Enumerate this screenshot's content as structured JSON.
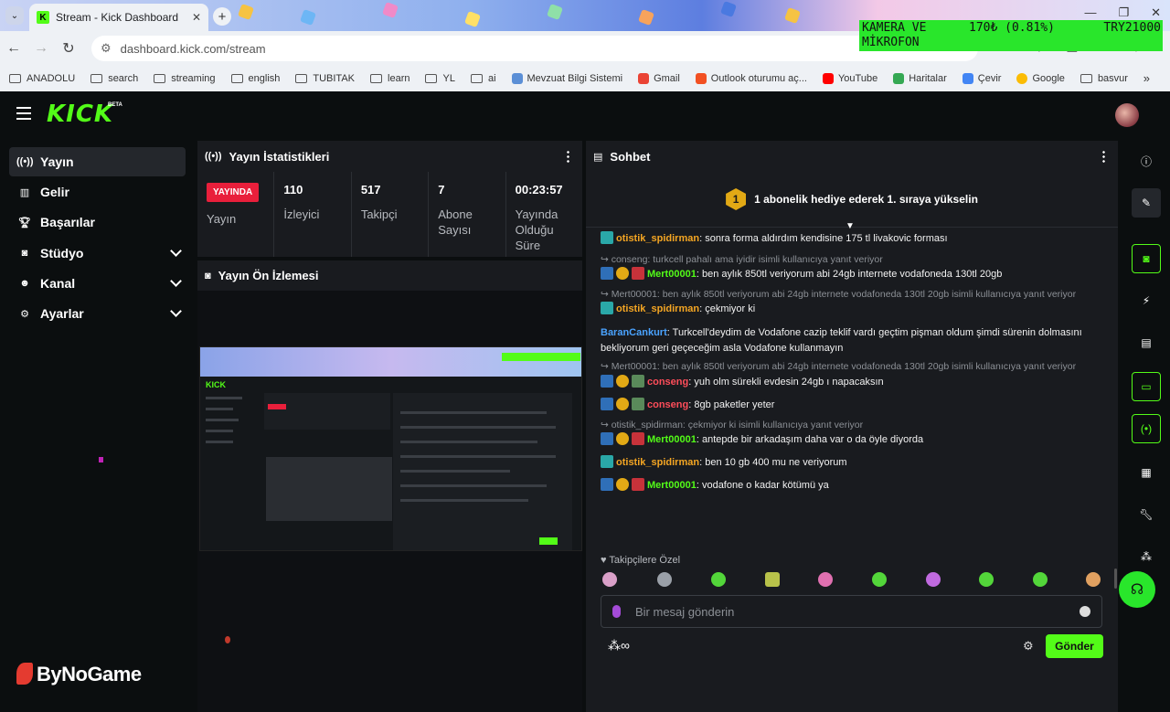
{
  "browser": {
    "tab_title": "Stream - Kick Dashboard",
    "url": "dashboard.kick.com/stream",
    "overlay_label": "KAMERA VE MİKROFON",
    "overlay_price": "170₺ (0.81%)",
    "overlay_amount": "TRY21000",
    "bookmarks": [
      "ANADOLU",
      "search",
      "streaming",
      "english",
      "TUBITAK",
      "learn",
      "YL",
      "ai",
      "Mevzuat Bilgi Sistemi",
      "Gmail",
      "Outlook oturumu aç...",
      "YouTube",
      "Haritalar",
      "Çevir",
      "Google",
      "basvur"
    ]
  },
  "app": {
    "logo": "KICK",
    "beta": "BETA"
  },
  "sidebar": {
    "items": [
      {
        "label": "Yayın",
        "icon": "broadcast-icon"
      },
      {
        "label": "Gelir",
        "icon": "chart-icon"
      },
      {
        "label": "Başarılar",
        "icon": "trophy-icon"
      },
      {
        "label": "Stüdyo",
        "icon": "studio-icon"
      },
      {
        "label": "Kanal",
        "icon": "people-icon"
      },
      {
        "label": "Ayarlar",
        "icon": "gear-icon"
      }
    ],
    "watermark": "ByNoGame"
  },
  "stats": {
    "title": "Yayın İstatistikleri",
    "live_badge": "YAYINDA",
    "live_label": "Yayın",
    "items": [
      {
        "value": "110",
        "label": "İzleyici"
      },
      {
        "value": "517",
        "label": "Takipçi"
      },
      {
        "value": "7",
        "label": "Abone Sayısı"
      },
      {
        "value": "00:23:57",
        "label": "Yayında Olduğu Süre"
      }
    ]
  },
  "preview": {
    "title": "Yayın Ön İzlemesi"
  },
  "chat": {
    "title": "Sohbet",
    "pinned": "1 abonelik hediye ederek 1. sıraya yükselin",
    "pinned_rank": "1",
    "messages": [
      {
        "reply": "",
        "user": "otistik_spidirman",
        "color": "orange",
        "text": "sonra forma aldırdım kendisine 175 tl livakovic forması"
      },
      {
        "reply": "conseng: turkcell pahalı ama iyidir isimli kullanıcıya yanıt veriyor",
        "user": "Mert00001",
        "color": "green",
        "text": "ben aylık 850tl veriyorum abi 24gb internete vodafoneda 130tl 20gb"
      },
      {
        "reply": "Mert00001: ben aylık 850tl veriyorum abi 24gb internete vodafoneda 130tl 20gb isimli kullanıcıya yanıt veriyor",
        "user": "otistik_spidirman",
        "color": "orange",
        "text": "çekmiyor ki"
      },
      {
        "reply": "",
        "user": "BaranCankurt",
        "color": "blue",
        "text": "Turkcell'deydim de Vodafone cazip teklif vardı geçtim pişman oldum şimdi sürenin dolmasını bekliyorum geri geçeceğim asla Vodafone kullanmayın"
      },
      {
        "reply": "Mert00001: ben aylık 850tl veriyorum abi 24gb internete vodafoneda 130tl 20gb isimli kullanıcıya yanıt veriyor",
        "user": "conseng",
        "color": "red",
        "text": "yuh olm sürekli evdesin 24gb ı napacaksın"
      },
      {
        "reply": "",
        "user": "conseng",
        "color": "red",
        "text": "8gb paketler yeter"
      },
      {
        "reply": "otistik_spidirman: çekmiyor ki isimli kullanıcıya yanıt veriyor",
        "user": "Mert00001",
        "color": "green",
        "text": "antepde bir arkadaşım daha var o da öyle diyorda"
      },
      {
        "reply": "",
        "user": "otistik_spidirman",
        "color": "orange",
        "text": "ben 10 gb 400 mu ne veriyorum"
      },
      {
        "reply": "",
        "user": "Mert00001",
        "color": "green",
        "text": "vodafone o kadar kötümü ya"
      }
    ],
    "followers_only": "Takipçilere Özel",
    "input_placeholder": "Bir mesaj gönderin",
    "send_label": "Gönder"
  },
  "rail": {
    "icons": [
      "info-icon",
      "pencil-icon",
      "camera-icon",
      "bolt-icon",
      "notes-icon",
      "chat-icon",
      "broadcast-icon",
      "layout-icon",
      "wrench-icon",
      "share-icon"
    ]
  },
  "colors": {
    "accent": "#53fc18",
    "live": "#e91f3b",
    "bg": "#0b0e0f",
    "panel": "#191b1f"
  }
}
